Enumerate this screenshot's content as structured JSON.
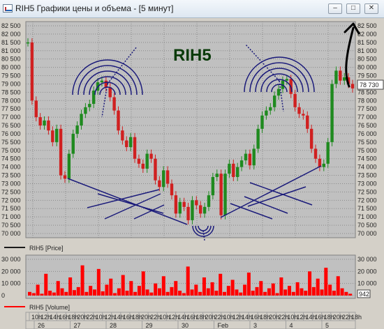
{
  "window": {
    "title": "RIH5 Графики цены и объема - [5 минут]",
    "buttons": {
      "minimize": "–",
      "restore": "□",
      "close": "✕"
    }
  },
  "chart_data": [
    {
      "type": "line",
      "title": "RIH5",
      "series": [
        {
          "name": "RIH5 [Price]",
          "color": "#c00000",
          "values": [
            81500,
            78000,
            77000,
            76500,
            76800,
            76200,
            75500,
            76300,
            73500,
            73300,
            74800,
            76000,
            76500,
            77200,
            77600,
            77800,
            78600,
            79100,
            79200,
            78800,
            78200,
            77400,
            76200,
            75600,
            75200,
            75800,
            74500,
            74200,
            73900,
            74800,
            74500,
            73200,
            72800,
            73800,
            73000,
            72300,
            71200,
            71900,
            71600,
            70800,
            72000,
            71700,
            71200,
            71600,
            72300,
            73400,
            73600,
            71100,
            73600,
            74200,
            73400,
            74000,
            74400,
            74800,
            74100,
            75100,
            76300,
            77100,
            77400,
            77600,
            78300,
            78700,
            79200,
            79300,
            78400,
            77600,
            77200,
            77100,
            76300,
            75100,
            74500,
            74000,
            74200,
            75500,
            79000,
            79800,
            79200,
            79400,
            79000,
            78730
          ]
        }
      ],
      "y_ticks": [
        "82 500",
        "82 000",
        "81 500",
        "81 000",
        "80 500",
        "80 000",
        "79 500",
        "79 000",
        "78 500",
        "78 000",
        "77 500",
        "77 000",
        "76 500",
        "76 000",
        "75 500",
        "75 000",
        "74 500",
        "74 000",
        "73 500",
        "73 000",
        "72 500",
        "72 000",
        "71 500",
        "71 000",
        "70 500",
        "70 000"
      ],
      "ylim": [
        70000,
        82500
      ],
      "last_price_label": "78 730",
      "grid": true
    },
    {
      "type": "bar",
      "series": [
        {
          "name": "RIH5 [Volume]",
          "color": "#ff0000",
          "values": [
            3000,
            2000,
            9000,
            1500,
            18000,
            4000,
            2500,
            12000,
            6000,
            3000,
            15000,
            4500,
            7000,
            25000,
            3000,
            8000,
            5000,
            22000,
            3500,
            9000,
            14000,
            2000,
            6000,
            17000,
            4000,
            12000,
            3000,
            8000,
            20000,
            5000,
            2500,
            10000,
            6000,
            16000,
            3000,
            7000,
            12000,
            4000,
            2000,
            24000,
            5000,
            9000,
            3000,
            15000,
            6000,
            11000,
            4000,
            18000,
            3000,
            8000,
            13000,
            5000,
            2500,
            9000,
            19000,
            4000,
            7000,
            12000,
            3000,
            6000,
            10000,
            2000,
            15000,
            5000,
            8000,
            3000,
            11000,
            6000,
            4000,
            20000,
            7000,
            14000,
            5000,
            23000,
            9000,
            4000,
            16000,
            6000,
            3000,
            1500
          ]
        }
      ],
      "y_ticks": [
        "30 000",
        "20 000",
        "10 000",
        "0"
      ],
      "ylim": [
        0,
        30000
      ],
      "last_volume_label": "942",
      "grid": true
    }
  ],
  "time_axis": {
    "hours": [
      "10h",
      "12h",
      "14h",
      "16h",
      "18h",
      "20h",
      "22h",
      "10h",
      "12h",
      "14h",
      "16h",
      "18h",
      "20h",
      "22h",
      "10h",
      "12h",
      "14h",
      "16h",
      "18h",
      "20h",
      "22h",
      "10h",
      "12h",
      "14h",
      "16h",
      "18h",
      "20h",
      "22h",
      "10h",
      "12h",
      "14h",
      "16h",
      "18h",
      "20h",
      "22h",
      "18h"
    ],
    "days": [
      "26",
      "27",
      "28",
      "29",
      "30",
      "Feb",
      "3",
      "4",
      "5"
    ]
  },
  "colors": {
    "plot_bg": "#c0c0c0",
    "grid": "#8a8a8a",
    "price_down": "#d02020",
    "price_up": "#1f8a1f",
    "volume": "#ff0000",
    "annotation": "#1a1a7a",
    "title_text": "#0a3a0a",
    "arrow": "#000000"
  }
}
